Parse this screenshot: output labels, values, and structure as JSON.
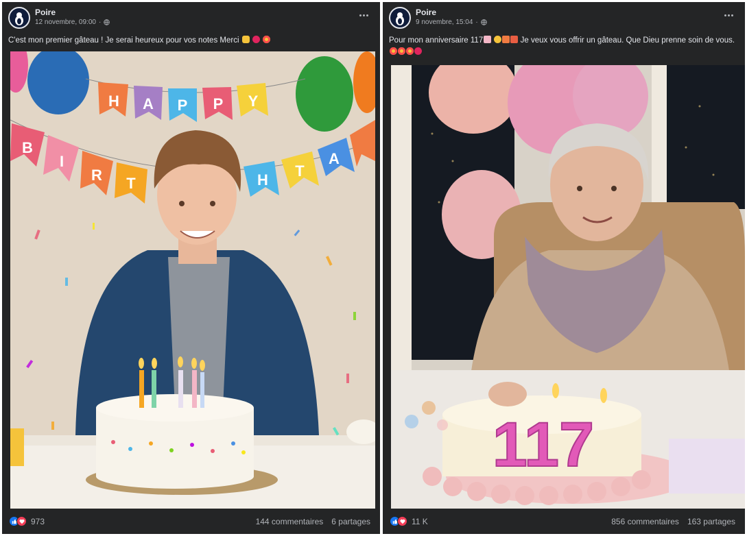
{
  "posts": [
    {
      "author": "Poire",
      "date": "12 novembre, 09:00",
      "caption": "C'est mon premier gâteau ! Je serai heureux pour vos notes Merci",
      "emoji_icons": [
        "thumbs-up-icon",
        "red-heart-icon",
        "star-struck-icon"
      ],
      "photo_text": {
        "banner_top": [
          "H",
          "A",
          "P",
          "P",
          "Y"
        ],
        "banner_bottom": [
          "B",
          "I",
          "R",
          "T",
          "H",
          "T",
          "A"
        ]
      },
      "reaction_count": "973",
      "comments": "144 commentaires",
      "shares": "6 partages"
    },
    {
      "author": "Poire",
      "date": "9 novembre, 15:04",
      "caption": "Pour mon anniversaire 117",
      "caption_rest": "Je veux vous offrir un gâteau. Que Dieu prenne soin de vous.",
      "emoji_icons": [
        "cake-icon",
        "clapping-icon",
        "party-popper-icon",
        "gift-icon",
        "star-struck-icon",
        "star-struck-icon",
        "star-struck-icon",
        "red-heart-icon"
      ],
      "photo_text": {
        "candles": "117"
      },
      "reaction_count": "11 K",
      "comments": "856 commentaires",
      "shares": "163 partages"
    }
  ],
  "colors": {
    "card_bg": "#242526",
    "text_primary": "#e4e6eb",
    "text_secondary": "#b0b3b8",
    "like_blue": "#1877f2",
    "love_red": "#f33e58"
  }
}
